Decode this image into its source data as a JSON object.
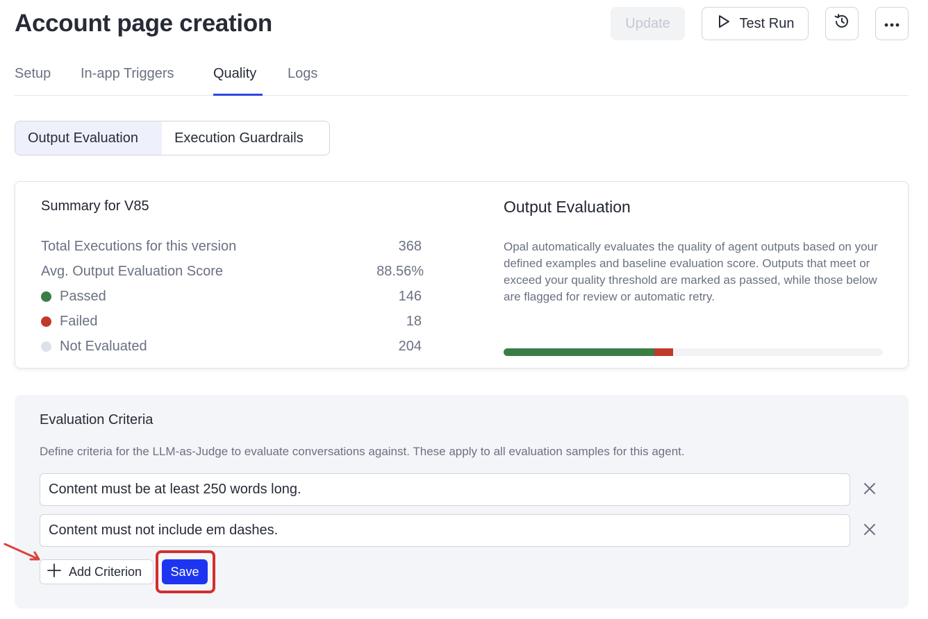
{
  "header": {
    "title": "Account page creation",
    "update_label": "Update",
    "test_run_label": "Test Run"
  },
  "tabs": [
    {
      "label": "Setup"
    },
    {
      "label": "In-app Triggers"
    },
    {
      "label": "Quality"
    },
    {
      "label": "Logs"
    }
  ],
  "active_tab": "Quality",
  "segmented": {
    "options": [
      "Output Evaluation",
      "Execution Guardrails"
    ],
    "selected": "Output Evaluation"
  },
  "summary": {
    "title": "Summary for V85",
    "rows": [
      {
        "label": "Total Executions for this version",
        "value": "368"
      },
      {
        "label": "Avg. Output Evaluation Score",
        "value": "88.56%"
      },
      {
        "label": "Passed",
        "value": "146",
        "color": "#3a7d46"
      },
      {
        "label": "Failed",
        "value": "18",
        "color": "#c0392b"
      },
      {
        "label": "Not Evaluated",
        "value": "204",
        "color": "#dde1ea"
      }
    ]
  },
  "output_evaluation": {
    "title": "Output Evaluation",
    "description": "Opal automatically evaluates the quality of agent outputs based on your defined examples and baseline evaluation score. Outputs that meet or exceed your quality threshold are marked as passed, while those below are flagged for review or automatic retry.",
    "progress": [
      {
        "name": "passed",
        "fraction": 0.397,
        "color": "#3a7d46"
      },
      {
        "name": "failed",
        "fraction": 0.049,
        "color": "#c0392b"
      }
    ]
  },
  "criteria": {
    "title": "Evaluation Criteria",
    "description": "Define criteria for the LLM-as-Judge to evaluate conversations against. These apply to all evaluation samples for this agent.",
    "items": [
      {
        "value": "Content must be at least 250 words long."
      },
      {
        "value": "Content must not include em dashes."
      }
    ],
    "add_label": "Add Criterion",
    "save_label": "Save"
  },
  "colors": {
    "accent": "#1d35f0",
    "tab_underline": "#2c46e0",
    "highlight": "#d32f2f"
  },
  "icons": [
    "play-icon",
    "history-icon",
    "more-icon",
    "close-icon",
    "plus-icon"
  ]
}
